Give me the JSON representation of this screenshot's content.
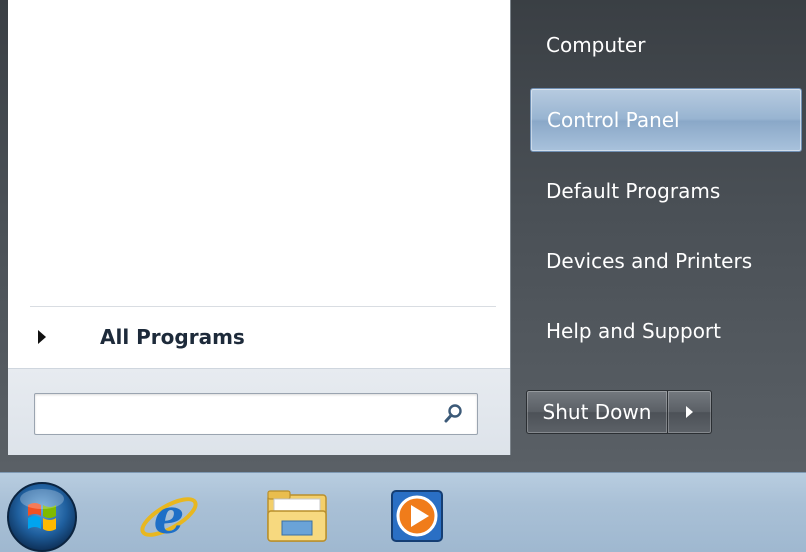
{
  "left_pane": {
    "all_programs_label": "All Programs",
    "search": {
      "value": "",
      "placeholder": ""
    }
  },
  "right_pane": {
    "items": [
      {
        "label": "Computer",
        "selected": false
      },
      {
        "label": "Control Panel",
        "selected": true
      },
      {
        "label": "Default Programs",
        "selected": false
      },
      {
        "label": "Devices and Printers",
        "selected": false
      },
      {
        "label": "Help and Support",
        "selected": false
      }
    ],
    "shutdown_label": "Shut Down"
  },
  "taskbar": {
    "apps": [
      {
        "icon": "internet-explorer-icon"
      },
      {
        "icon": "windows-explorer-icon"
      },
      {
        "icon": "media-player-icon"
      }
    ]
  },
  "colors": {
    "selected_highlight": "#98b4d1",
    "menu_dark": "#4a5056",
    "taskbar": "#a9c0d6"
  }
}
